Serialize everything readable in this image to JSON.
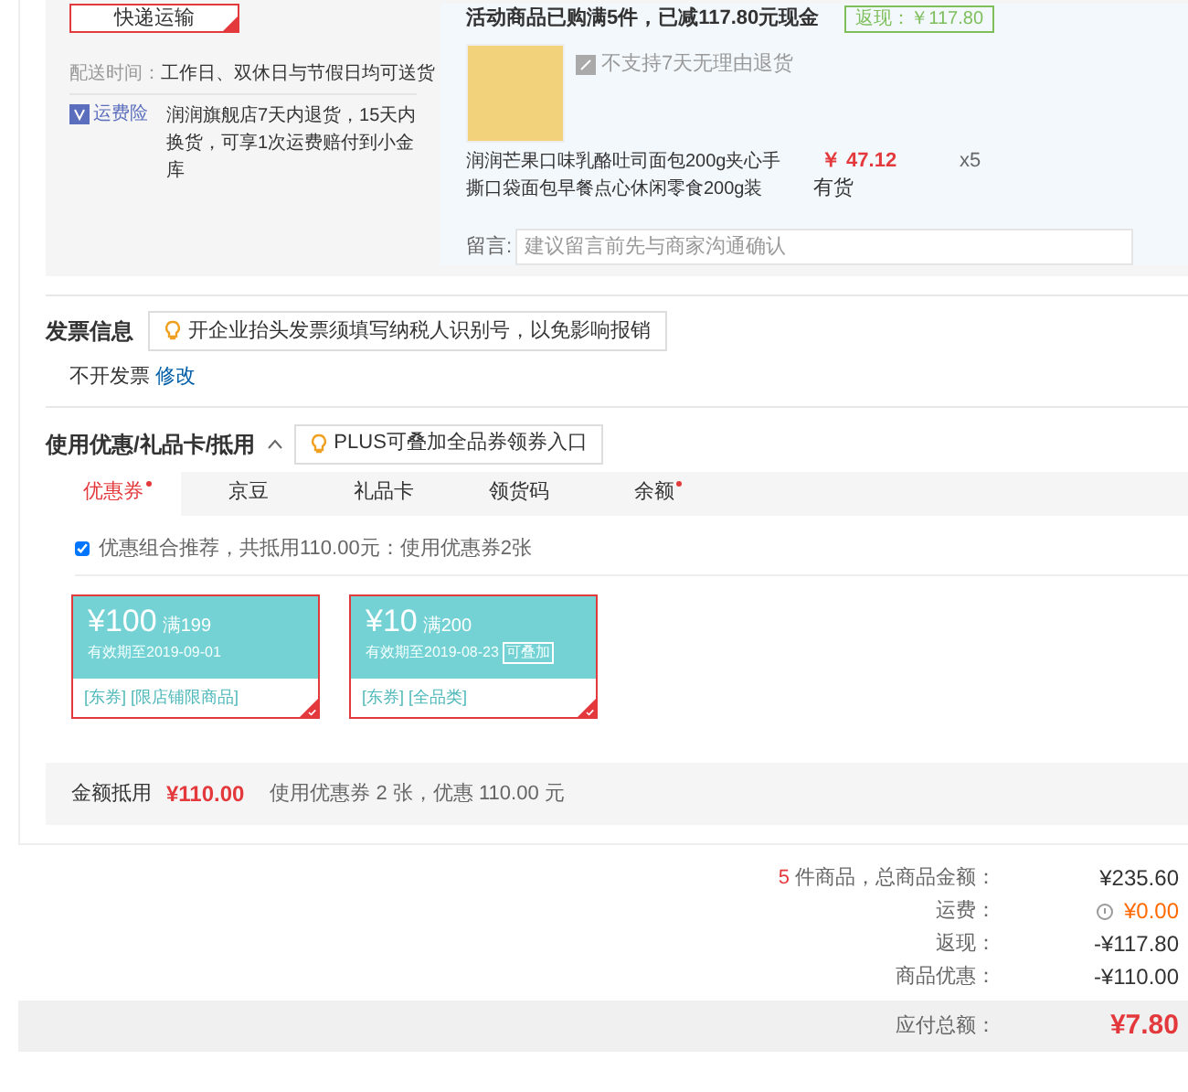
{
  "shipping": {
    "method_button": "快递运输",
    "time_label": "配送时间：",
    "time_value": "工作日、双休日与节假日均可送货",
    "insurance_badge": "运费险",
    "insurance_text": "润润旗舰店7天内退货，15天内换货，可享1次运费赔付到小金库"
  },
  "promo": {
    "text": "活动商品已购满5件，已减117.80元现金",
    "tag": "返现：￥117.80"
  },
  "product": {
    "return_note": "不支持7天无理由退货",
    "name": "润润芒果口味乳酪吐司面包200g夹心手撕口袋面包早餐点心休闲零食200g装",
    "price": "￥ 47.12",
    "stock": "有货",
    "quantity": "x5"
  },
  "message": {
    "label": "留言:",
    "placeholder": "建议留言前先与商家沟通确认"
  },
  "invoice": {
    "title": "发票信息",
    "tip": "开企业抬头发票须填写纳税人识别号，以免影响报销",
    "value": "不开发票",
    "edit_link": "修改"
  },
  "discounts": {
    "title": "使用优惠/礼品卡/抵用",
    "expanded": true,
    "tip": "PLUS可叠加全品券领券入口",
    "tabs": [
      {
        "label": "优惠券",
        "selected": true,
        "dot": true
      },
      {
        "label": "京豆",
        "selected": false,
        "dot": false
      },
      {
        "label": "礼品卡",
        "selected": false,
        "dot": false
      },
      {
        "label": "领货码",
        "selected": false,
        "dot": false
      },
      {
        "label": "余额",
        "selected": false,
        "dot": true
      }
    ],
    "recommend": {
      "checked": true,
      "text": "优惠组合推荐，共抵用110.00元：使用优惠券2张"
    },
    "coupons": [
      {
        "amount": "¥100",
        "threshold": "满199",
        "validity": "有效期至2019-09-01",
        "tags": "[东券] [限店铺限商品]",
        "selected": true
      },
      {
        "amount": "¥10",
        "threshold": "满200",
        "validity": "有效期至2019-08-23",
        "stackable": "可叠加",
        "tags": "[东券] [全品类]",
        "selected": true
      }
    ],
    "summary_label": "金额抵用",
    "summary_amount": "¥110.00",
    "summary_text": "使用优惠券 2 张，优惠 110.00 元"
  },
  "totals": {
    "count": "5",
    "count_label": "件商品，总商品金额：",
    "goods_amount": "¥235.60",
    "rows": [
      {
        "label": "运费：",
        "value": "¥0.00",
        "kind": "fee"
      },
      {
        "label": "返现：",
        "value": "-¥117.80",
        "kind": "plain"
      },
      {
        "label": "商品优惠：",
        "value": "-¥110.00",
        "kind": "plain"
      }
    ],
    "payable_label": "应付总额：",
    "payable": "¥7.80"
  }
}
